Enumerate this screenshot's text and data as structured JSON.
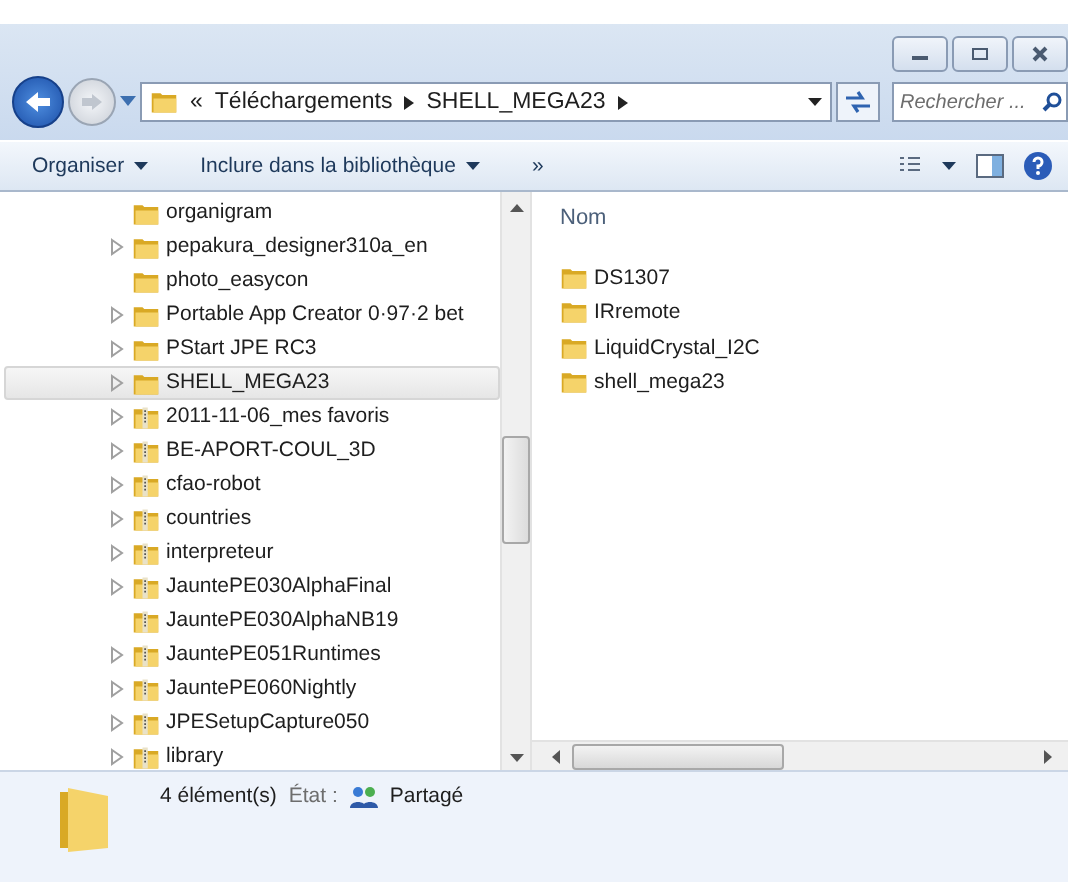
{
  "window": {
    "buttons": [
      {
        "kind": "minimize"
      },
      {
        "kind": "maximize"
      },
      {
        "kind": "close"
      }
    ]
  },
  "address_bar": {
    "overflow": "«",
    "crumbs": [
      "Téléchargements",
      "SHELL_MEGA23"
    ]
  },
  "search": {
    "placeholder": "Rechercher ..."
  },
  "toolbar": {
    "items": [
      "Organiser",
      "Inclure dans la bibliothèque"
    ],
    "more": "»"
  },
  "tree": {
    "items": [
      {
        "label": "organigram",
        "kind": "folder",
        "has_children": false,
        "selected": false
      },
      {
        "label": "pepakura_designer310a_en",
        "kind": "folder",
        "has_children": true,
        "selected": false
      },
      {
        "label": "photo_easycon",
        "kind": "folder",
        "has_children": false,
        "selected": false
      },
      {
        "label": "Portable App Creator 0·97·2 bet",
        "kind": "folder",
        "has_children": true,
        "selected": false
      },
      {
        "label": "PStart JPE RC3",
        "kind": "folder",
        "has_children": true,
        "selected": false
      },
      {
        "label": "SHELL_MEGA23",
        "kind": "folder",
        "has_children": true,
        "selected": true
      },
      {
        "label": "2011-11-06_mes favoris",
        "kind": "zipped",
        "has_children": true,
        "selected": false
      },
      {
        "label": "BE-APORT-COUL_3D",
        "kind": "zipped",
        "has_children": true,
        "selected": false
      },
      {
        "label": "cfao-robot",
        "kind": "zipped",
        "has_children": true,
        "selected": false
      },
      {
        "label": "countries",
        "kind": "zipped",
        "has_children": true,
        "selected": false
      },
      {
        "label": "interpreteur",
        "kind": "zipped",
        "has_children": true,
        "selected": false
      },
      {
        "label": "JauntePE030AlphaFinal",
        "kind": "zipped",
        "has_children": true,
        "selected": false
      },
      {
        "label": "JauntePE030AlphaNB19",
        "kind": "zipped",
        "has_children": false,
        "selected": false
      },
      {
        "label": "JauntePE051Runtimes",
        "kind": "zipped",
        "has_children": true,
        "selected": false
      },
      {
        "label": "JauntePE060Nightly",
        "kind": "zipped",
        "has_children": true,
        "selected": false
      },
      {
        "label": "JPESetupCapture050",
        "kind": "zipped",
        "has_children": true,
        "selected": false
      },
      {
        "label": "library",
        "kind": "zipped",
        "has_children": true,
        "selected": false
      }
    ]
  },
  "files": {
    "column": "Nom",
    "items": [
      "DS1307",
      "IRremote",
      "LiquidCrystal_I2C",
      "shell_mega23"
    ]
  },
  "status_bar": {
    "count": "4 élément(s)",
    "state_label": "État :",
    "state_value": "Partagé"
  }
}
